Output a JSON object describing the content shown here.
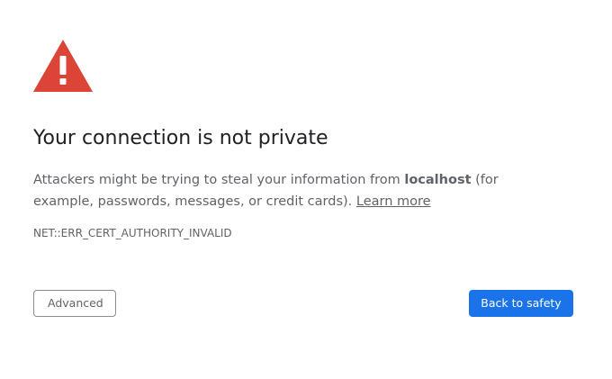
{
  "interstitial": {
    "icon": "warning-triangle-icon",
    "icon_color": "#db4437",
    "title": "Your connection is not private",
    "explanation_before": "Attackers might be trying to steal your information from ",
    "host": "localhost",
    "explanation_after": " (for example, passwords, messages, or credit cards). ",
    "learn_more": "Learn more",
    "error_code": "NET::ERR_CERT_AUTHORITY_INVALID"
  },
  "buttons": {
    "advanced_label": "Advanced",
    "back_label": "Back to safety",
    "primary_color": "#1a73e8"
  }
}
